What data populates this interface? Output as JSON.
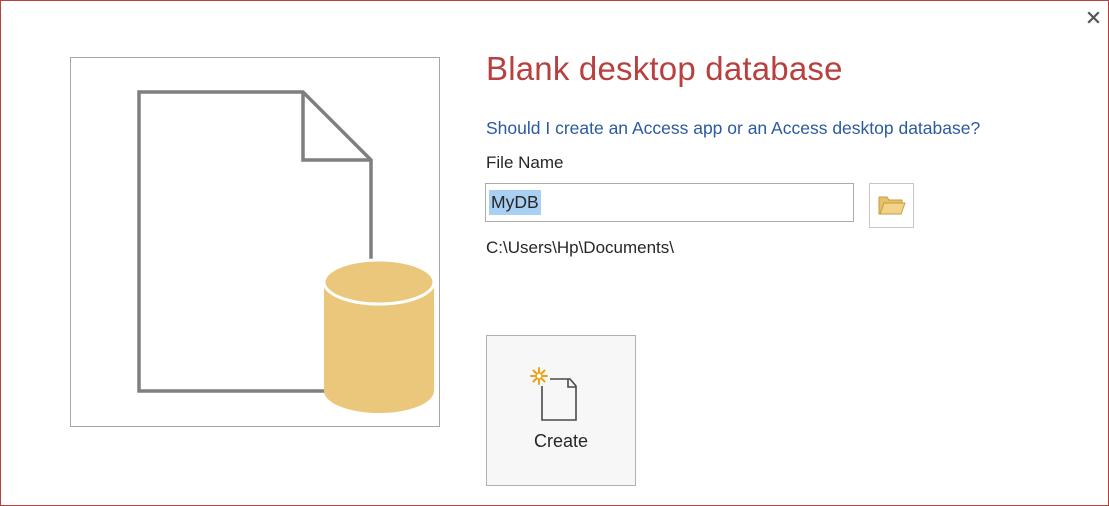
{
  "dialog": {
    "title": "Blank desktop database",
    "help_link": "Should I create an Access app or an Access desktop database?",
    "file_name_label": "File Name",
    "file_name_value": "MyDB",
    "path": "C:\\Users\\Hp\\Documents\\",
    "create_label": "Create",
    "icons": {
      "close": "close-icon",
      "browse": "folder-icon",
      "preview": "database-document-icon",
      "create": "new-document-icon"
    },
    "colors": {
      "accent": "#b8403f",
      "link": "#2a5aa0",
      "selection": "#a9cff2",
      "cylinder": "#ebc77c"
    }
  }
}
